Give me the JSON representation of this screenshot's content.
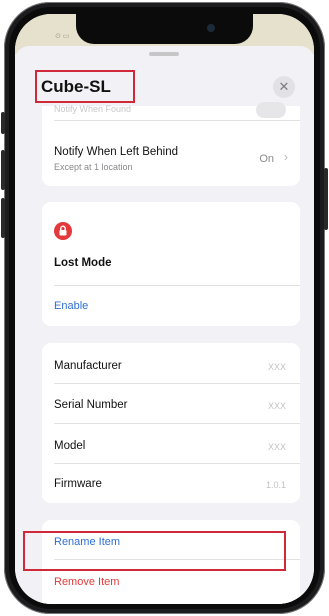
{
  "sheet": {
    "title": "Cube-SL",
    "close_symbol": "✕"
  },
  "notifications": {
    "faded_label": "Notify When Found",
    "left_behind_label": "Notify When Left Behind",
    "left_behind_sub": "Except at 1 location",
    "left_behind_value": "On",
    "chevron_symbol": "›"
  },
  "lost_mode": {
    "title": "Lost Mode",
    "enable_label": "Enable",
    "icon": "lock-icon"
  },
  "info": {
    "rows": [
      {
        "label": "Manufacturer",
        "value": "XXX"
      },
      {
        "label": "Serial Number",
        "value": "XXX"
      },
      {
        "label": "Model",
        "value": "XXX"
      },
      {
        "label": "Firmware",
        "value": "1.0.1"
      }
    ]
  },
  "actions": {
    "rename_label": "Rename Item",
    "remove_label": "Remove Item"
  },
  "colors": {
    "link_blue": "#2f6fd1",
    "destructive_red": "#e23a3a",
    "highlight_red": "#d02a3a"
  }
}
